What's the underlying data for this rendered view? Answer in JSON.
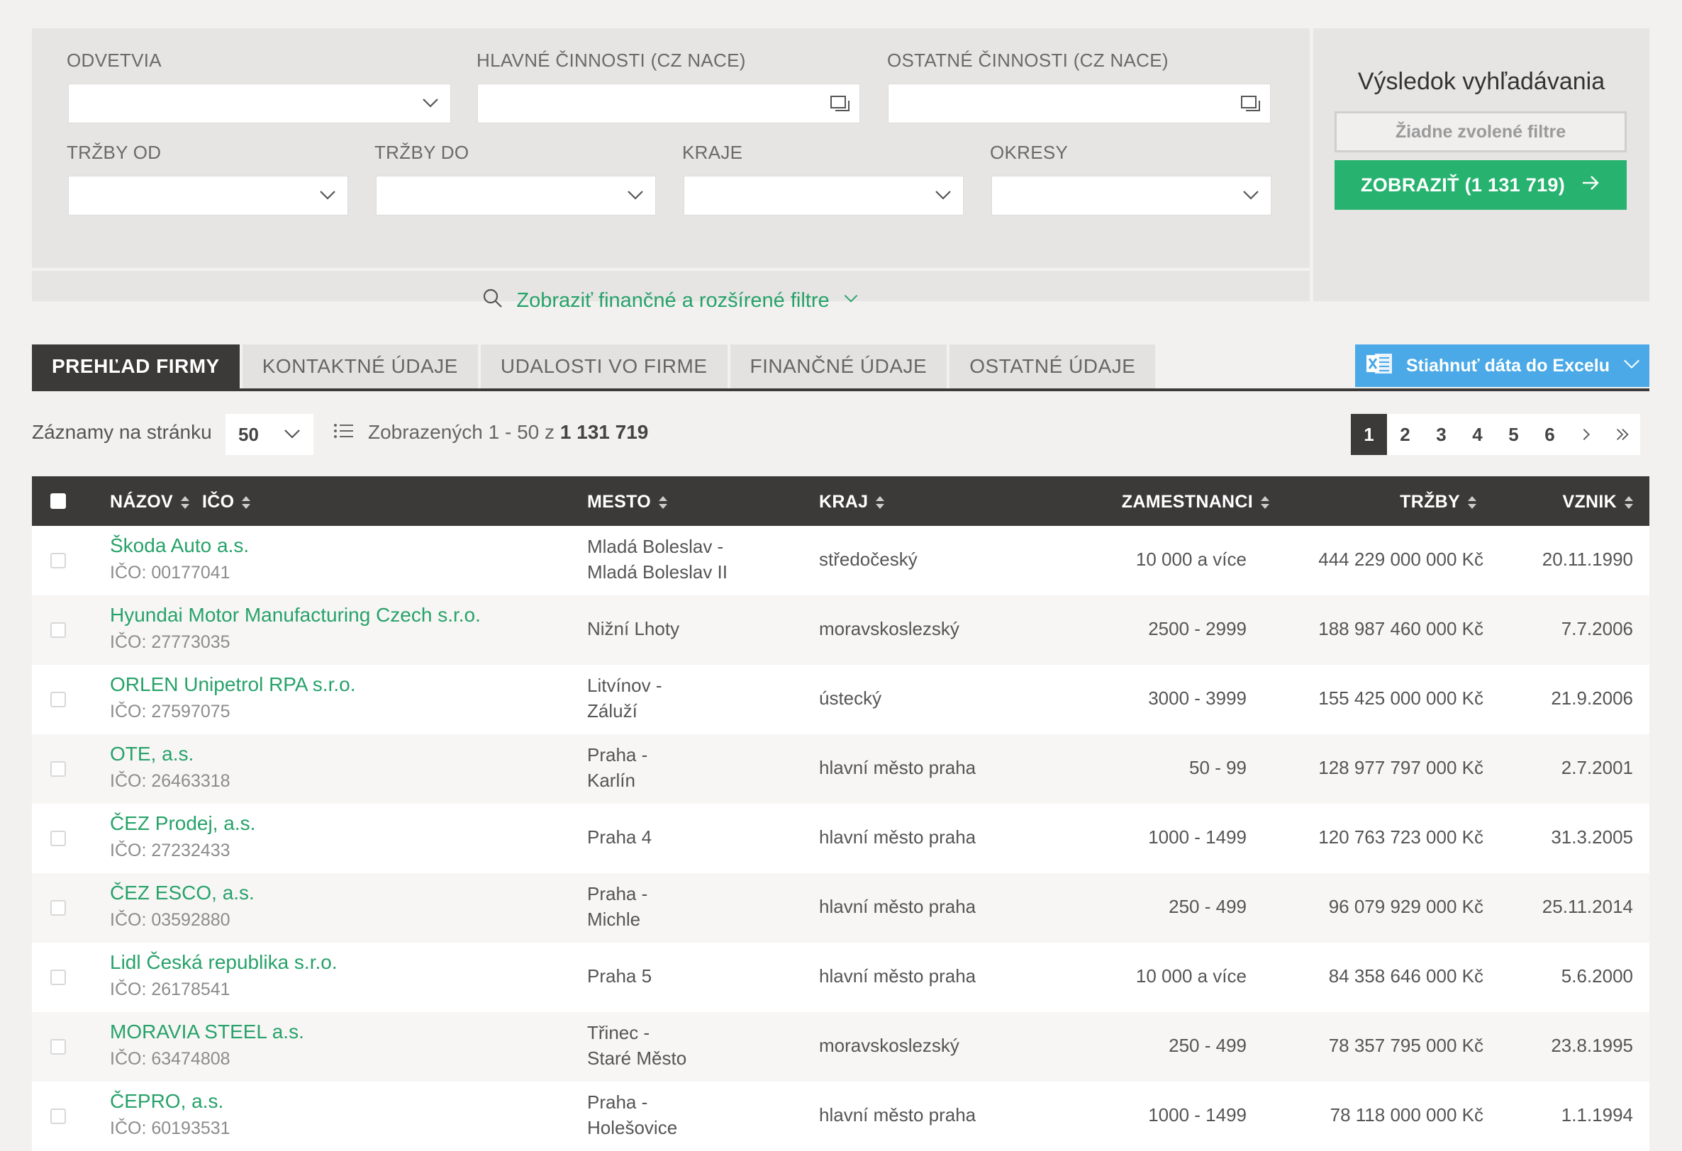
{
  "filters": {
    "odvetvia_label": "ODVETVIA",
    "hlavne_label": "HLAVNÉ ČINNOSTI (CZ NACE)",
    "ostatne_label": "OSTATNÉ ČINNOSTI (CZ NACE)",
    "trzby_od_label": "TRŽBY OD",
    "trzby_do_label": "TRŽBY DO",
    "kraje_label": "KRAJE",
    "okresy_label": "OKRESY",
    "advanced_label": "Zobraziť finančné a rozšírené filtre"
  },
  "result": {
    "title": "Výsledok vyhľadávania",
    "no_filters": "Žiadne zvolené filtre",
    "show_button": "ZOBRAZIŤ (1 131 719)"
  },
  "tabs": [
    {
      "label": "PREHĽAD FIRMY",
      "active": true
    },
    {
      "label": "KONTAKTNÉ ÚDAJE"
    },
    {
      "label": "UDALOSTI VO FIRME"
    },
    {
      "label": "FINANČNÉ ÚDAJE"
    },
    {
      "label": "OSTATNÉ ÚDAJE"
    }
  ],
  "excel_button": "Stiahnuť dáta do Excelu",
  "toolbar": {
    "per_page_label": "Záznamy na stránku",
    "per_page_value": "50",
    "shown_prefix": "Zobrazených 1 - 50 z",
    "shown_total": "1 131 719"
  },
  "pagination": [
    "1",
    "2",
    "3",
    "4",
    "5",
    "6"
  ],
  "columns": {
    "nazov": "NÁZOV",
    "ico": "IČO",
    "mesto": "MESTO",
    "kraj": "KRAJ",
    "zamestnanci": "ZAMESTNANCI",
    "trzby": "TRŽBY",
    "vznik": "VZNIK"
  },
  "rows": [
    {
      "name": "Škoda Auto a.s.",
      "ico": "IČO: 00177041",
      "mesto1": "Mladá Boleslav -",
      "mesto2": "Mladá Boleslav II",
      "kraj": "středočeský",
      "zam": "10 000 a více",
      "trzby": "444 229 000 000 Kč",
      "vznik": "20.11.1990"
    },
    {
      "name": "Hyundai Motor Manufacturing Czech s.r.o.",
      "ico": "IČO: 27773035",
      "mesto1": "Nižní Lhoty",
      "mesto2": "",
      "kraj": "moravskoslezský",
      "zam": "2500 - 2999",
      "trzby": "188 987 460 000 Kč",
      "vznik": "7.7.2006"
    },
    {
      "name": "ORLEN Unipetrol RPA s.r.o.",
      "ico": "IČO: 27597075",
      "mesto1": "Litvínov -",
      "mesto2": "Záluží",
      "kraj": "ústecký",
      "zam": "3000 - 3999",
      "trzby": "155 425 000 000 Kč",
      "vznik": "21.9.2006"
    },
    {
      "name": "OTE, a.s.",
      "ico": "IČO: 26463318",
      "mesto1": "Praha -",
      "mesto2": "Karlín",
      "kraj": "hlavní město praha",
      "zam": "50 - 99",
      "trzby": "128 977 797 000 Kč",
      "vznik": "2.7.2001"
    },
    {
      "name": "ČEZ Prodej, a.s.",
      "ico": "IČO: 27232433",
      "mesto1": "Praha 4",
      "mesto2": "",
      "kraj": "hlavní město praha",
      "zam": "1000 - 1499",
      "trzby": "120 763 723 000 Kč",
      "vznik": "31.3.2005"
    },
    {
      "name": "ČEZ ESCO, a.s.",
      "ico": "IČO: 03592880",
      "mesto1": "Praha -",
      "mesto2": "Michle",
      "kraj": "hlavní město praha",
      "zam": "250 - 499",
      "trzby": "96 079 929 000 Kč",
      "vznik": "25.11.2014"
    },
    {
      "name": "Lidl Česká republika s.r.o.",
      "ico": "IČO: 26178541",
      "mesto1": "Praha 5",
      "mesto2": "",
      "kraj": "hlavní město praha",
      "zam": "10 000 a více",
      "trzby": "84 358 646 000 Kč",
      "vznik": "5.6.2000"
    },
    {
      "name": "MORAVIA STEEL a.s.",
      "ico": "IČO: 63474808",
      "mesto1": "Třinec -",
      "mesto2": "Staré Město",
      "kraj": "moravskoslezský",
      "zam": "250 - 499",
      "trzby": "78 357 795 000 Kč",
      "vznik": "23.8.1995"
    },
    {
      "name": "ČEPRO, a.s.",
      "ico": "IČO: 60193531",
      "mesto1": "Praha -",
      "mesto2": "Holešovice",
      "kraj": "hlavní město praha",
      "zam": "1000 - 1499",
      "trzby": "78 118 000 000 Kč",
      "vznik": "1.1.1994"
    }
  ]
}
